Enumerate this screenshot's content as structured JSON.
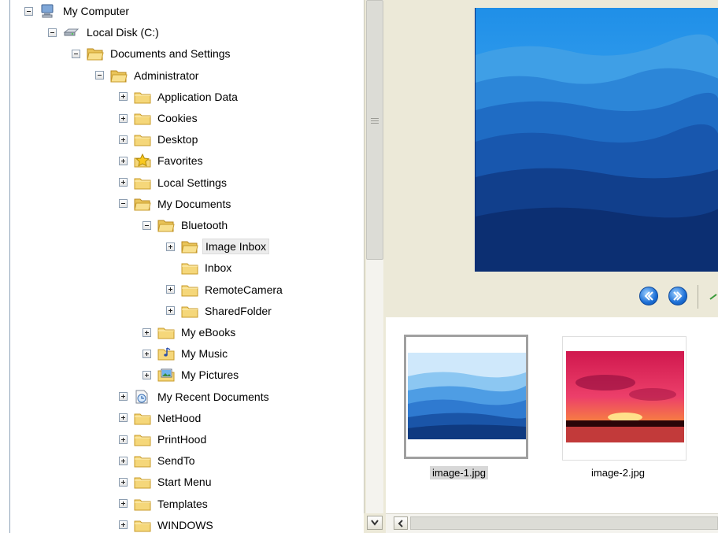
{
  "tree": {
    "nodes": [
      {
        "label": "My Computer",
        "expander": "minus",
        "icon": "computer-icon"
      },
      {
        "label": "Local Disk (C:)",
        "expander": "minus",
        "icon": "drive-icon"
      },
      {
        "label": "Documents and Settings",
        "expander": "minus",
        "icon": "folder-open-icon"
      },
      {
        "label": "Administrator",
        "expander": "minus",
        "icon": "folder-open-icon"
      },
      {
        "label": "Application Data",
        "expander": "plus",
        "icon": "folder-icon"
      },
      {
        "label": "Cookies",
        "expander": "plus",
        "icon": "folder-icon"
      },
      {
        "label": "Desktop",
        "expander": "plus",
        "icon": "folder-icon"
      },
      {
        "label": "Favorites",
        "expander": "plus",
        "icon": "star-folder-icon"
      },
      {
        "label": "Local Settings",
        "expander": "plus",
        "icon": "folder-icon"
      },
      {
        "label": "My Documents",
        "expander": "minus",
        "icon": "folder-open-icon"
      },
      {
        "label": "Bluetooth",
        "expander": "minus",
        "icon": "folder-open-icon"
      },
      {
        "label": "Image Inbox",
        "expander": "plus",
        "icon": "folder-open-icon",
        "selected": true
      },
      {
        "label": "Inbox",
        "expander": "none",
        "icon": "folder-icon"
      },
      {
        "label": "RemoteCamera",
        "expander": "plus",
        "icon": "folder-icon"
      },
      {
        "label": "SharedFolder",
        "expander": "plus",
        "icon": "folder-icon"
      },
      {
        "label": "My eBooks",
        "expander": "plus",
        "icon": "folder-icon"
      },
      {
        "label": "My Music",
        "expander": "plus",
        "icon": "music-folder-icon"
      },
      {
        "label": "My Pictures",
        "expander": "plus",
        "icon": "pictures-folder-icon"
      },
      {
        "label": "My Recent Documents",
        "expander": "plus",
        "icon": "recent-documents-icon"
      },
      {
        "label": "NetHood",
        "expander": "plus",
        "icon": "folder-icon"
      },
      {
        "label": "PrintHood",
        "expander": "plus",
        "icon": "folder-icon"
      },
      {
        "label": "SendTo",
        "expander": "plus",
        "icon": "folder-icon"
      },
      {
        "label": "Start Menu",
        "expander": "plus",
        "icon": "folder-icon"
      },
      {
        "label": "Templates",
        "expander": "plus",
        "icon": "folder-icon"
      },
      {
        "label": "WINDOWS",
        "expander": "plus",
        "icon": "folder-icon"
      }
    ]
  },
  "viewer": {
    "toolbar": {
      "prev_icon": "previous-icon",
      "next_icon": "next-icon"
    },
    "thumbnails": [
      {
        "caption": "image-1.jpg",
        "selected": true
      },
      {
        "caption": "image-2.jpg",
        "selected": false
      }
    ]
  },
  "colors": {
    "accent": "#1c6fd6",
    "selection": "#d8d8d8",
    "pane_background": "#ece9d8"
  }
}
